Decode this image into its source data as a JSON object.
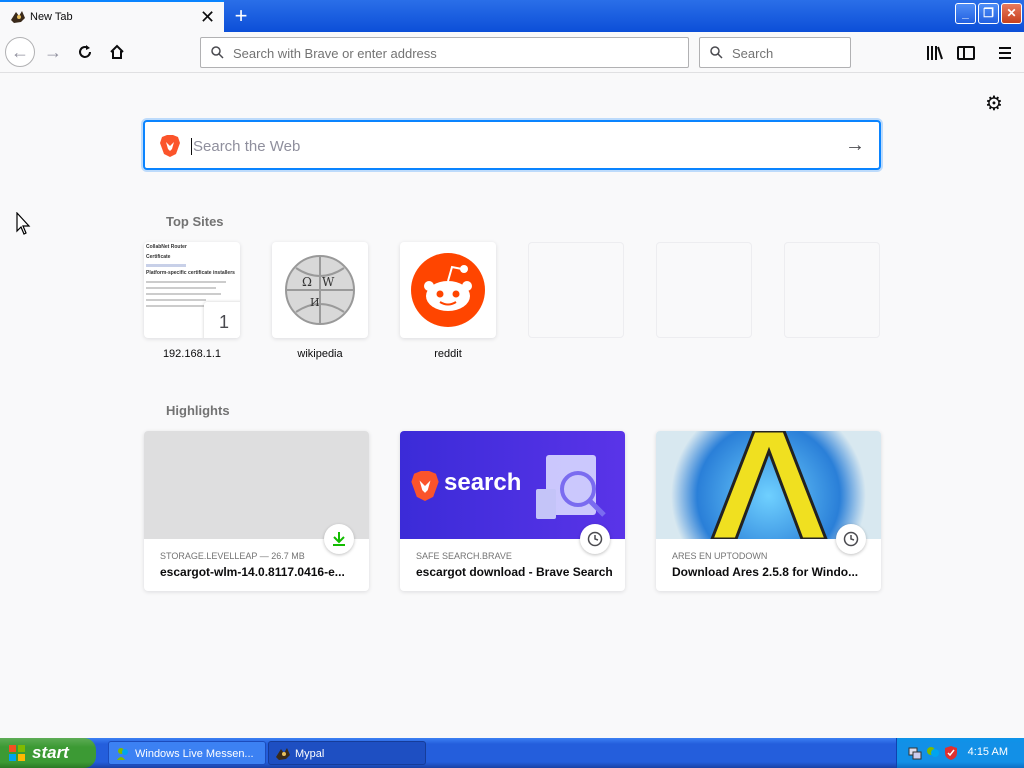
{
  "window": {
    "tab_title": "New Tab",
    "tab_close": "✕",
    "new_tab": "+"
  },
  "navbar": {
    "url_placeholder": "Search with Brave or enter address",
    "search_placeholder": "Search"
  },
  "content": {
    "web_search_placeholder": "Search the Web",
    "top_sites_title": "Top Sites",
    "top_sites": [
      {
        "label": "192.168.1.1",
        "pin_number": "1"
      },
      {
        "label": "wikipedia"
      },
      {
        "label": "reddit"
      }
    ],
    "router_preview_lines": [
      "CollabNet Router",
      "Certificate",
      "Platform-specific certificate installers"
    ],
    "highlights_title": "Highlights",
    "highlights": [
      {
        "source": "STORAGE.LEVELLEAP — 26.7 MB",
        "title": "escargot-wlm-14.0.8117.0416-e...",
        "badge": "download-icon"
      },
      {
        "source": "SAFE SEARCH.BRAVE",
        "title": "escargot download - Brave Search",
        "badge": "clock-icon",
        "image_text": "search"
      },
      {
        "source": "ARES EN UPTODOWN",
        "title": "Download Ares 2.5.8 for Windo...",
        "badge": "clock-icon"
      }
    ]
  },
  "taskbar": {
    "start_label": "start",
    "tasks": [
      {
        "label": "Windows Live Messen..."
      },
      {
        "label": "Mypal"
      }
    ],
    "clock": "4:15 AM"
  },
  "colors": {
    "accent": "#0a84ff",
    "reddit": "#ff4500",
    "brave": "#fb542b",
    "xp_blue": "#245edc",
    "xp_green": "#3c9a34"
  }
}
